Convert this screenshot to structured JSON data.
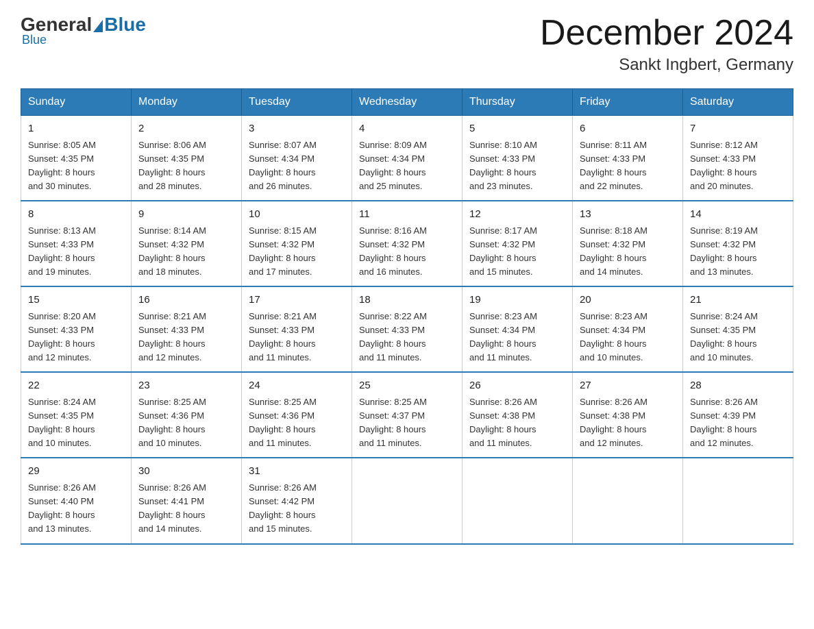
{
  "logo": {
    "general": "General",
    "blue": "Blue"
  },
  "header": {
    "month_year": "December 2024",
    "location": "Sankt Ingbert, Germany"
  },
  "weekdays": [
    "Sunday",
    "Monday",
    "Tuesday",
    "Wednesday",
    "Thursday",
    "Friday",
    "Saturday"
  ],
  "weeks": [
    [
      {
        "day": "1",
        "sunrise": "8:05 AM",
        "sunset": "4:35 PM",
        "daylight": "8 hours and 30 minutes."
      },
      {
        "day": "2",
        "sunrise": "8:06 AM",
        "sunset": "4:35 PM",
        "daylight": "8 hours and 28 minutes."
      },
      {
        "day": "3",
        "sunrise": "8:07 AM",
        "sunset": "4:34 PM",
        "daylight": "8 hours and 26 minutes."
      },
      {
        "day": "4",
        "sunrise": "8:09 AM",
        "sunset": "4:34 PM",
        "daylight": "8 hours and 25 minutes."
      },
      {
        "day": "5",
        "sunrise": "8:10 AM",
        "sunset": "4:33 PM",
        "daylight": "8 hours and 23 minutes."
      },
      {
        "day": "6",
        "sunrise": "8:11 AM",
        "sunset": "4:33 PM",
        "daylight": "8 hours and 22 minutes."
      },
      {
        "day": "7",
        "sunrise": "8:12 AM",
        "sunset": "4:33 PM",
        "daylight": "8 hours and 20 minutes."
      }
    ],
    [
      {
        "day": "8",
        "sunrise": "8:13 AM",
        "sunset": "4:33 PM",
        "daylight": "8 hours and 19 minutes."
      },
      {
        "day": "9",
        "sunrise": "8:14 AM",
        "sunset": "4:32 PM",
        "daylight": "8 hours and 18 minutes."
      },
      {
        "day": "10",
        "sunrise": "8:15 AM",
        "sunset": "4:32 PM",
        "daylight": "8 hours and 17 minutes."
      },
      {
        "day": "11",
        "sunrise": "8:16 AM",
        "sunset": "4:32 PM",
        "daylight": "8 hours and 16 minutes."
      },
      {
        "day": "12",
        "sunrise": "8:17 AM",
        "sunset": "4:32 PM",
        "daylight": "8 hours and 15 minutes."
      },
      {
        "day": "13",
        "sunrise": "8:18 AM",
        "sunset": "4:32 PM",
        "daylight": "8 hours and 14 minutes."
      },
      {
        "day": "14",
        "sunrise": "8:19 AM",
        "sunset": "4:32 PM",
        "daylight": "8 hours and 13 minutes."
      }
    ],
    [
      {
        "day": "15",
        "sunrise": "8:20 AM",
        "sunset": "4:33 PM",
        "daylight": "8 hours and 12 minutes."
      },
      {
        "day": "16",
        "sunrise": "8:21 AM",
        "sunset": "4:33 PM",
        "daylight": "8 hours and 12 minutes."
      },
      {
        "day": "17",
        "sunrise": "8:21 AM",
        "sunset": "4:33 PM",
        "daylight": "8 hours and 11 minutes."
      },
      {
        "day": "18",
        "sunrise": "8:22 AM",
        "sunset": "4:33 PM",
        "daylight": "8 hours and 11 minutes."
      },
      {
        "day": "19",
        "sunrise": "8:23 AM",
        "sunset": "4:34 PM",
        "daylight": "8 hours and 11 minutes."
      },
      {
        "day": "20",
        "sunrise": "8:23 AM",
        "sunset": "4:34 PM",
        "daylight": "8 hours and 10 minutes."
      },
      {
        "day": "21",
        "sunrise": "8:24 AM",
        "sunset": "4:35 PM",
        "daylight": "8 hours and 10 minutes."
      }
    ],
    [
      {
        "day": "22",
        "sunrise": "8:24 AM",
        "sunset": "4:35 PM",
        "daylight": "8 hours and 10 minutes."
      },
      {
        "day": "23",
        "sunrise": "8:25 AM",
        "sunset": "4:36 PM",
        "daylight": "8 hours and 10 minutes."
      },
      {
        "day": "24",
        "sunrise": "8:25 AM",
        "sunset": "4:36 PM",
        "daylight": "8 hours and 11 minutes."
      },
      {
        "day": "25",
        "sunrise": "8:25 AM",
        "sunset": "4:37 PM",
        "daylight": "8 hours and 11 minutes."
      },
      {
        "day": "26",
        "sunrise": "8:26 AM",
        "sunset": "4:38 PM",
        "daylight": "8 hours and 11 minutes."
      },
      {
        "day": "27",
        "sunrise": "8:26 AM",
        "sunset": "4:38 PM",
        "daylight": "8 hours and 12 minutes."
      },
      {
        "day": "28",
        "sunrise": "8:26 AM",
        "sunset": "4:39 PM",
        "daylight": "8 hours and 12 minutes."
      }
    ],
    [
      {
        "day": "29",
        "sunrise": "8:26 AM",
        "sunset": "4:40 PM",
        "daylight": "8 hours and 13 minutes."
      },
      {
        "day": "30",
        "sunrise": "8:26 AM",
        "sunset": "4:41 PM",
        "daylight": "8 hours and 14 minutes."
      },
      {
        "day": "31",
        "sunrise": "8:26 AM",
        "sunset": "4:42 PM",
        "daylight": "8 hours and 15 minutes."
      },
      null,
      null,
      null,
      null
    ]
  ],
  "labels": {
    "sunrise": "Sunrise:",
    "sunset": "Sunset:",
    "daylight": "Daylight:"
  }
}
